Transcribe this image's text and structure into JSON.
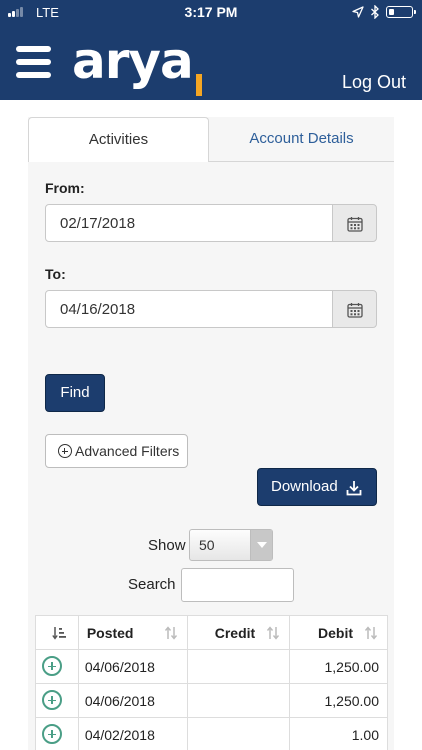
{
  "status_bar": {
    "carrier": "LTE",
    "time": "3:17 PM"
  },
  "header": {
    "logo_text": "arya",
    "logout_label": "Log Out"
  },
  "tabs": [
    {
      "label": "Activities",
      "active": true
    },
    {
      "label": "Account Details",
      "active": false
    }
  ],
  "form": {
    "from_label": "From:",
    "from_value": "02/17/2018",
    "to_label": "To:",
    "to_value": "04/16/2018",
    "find_label": "Find",
    "advanced_filters_label": "Advanced Filters",
    "download_label": "Download"
  },
  "table_controls": {
    "show_label": "Show",
    "show_value": "50",
    "search_label": "Search",
    "search_value": ""
  },
  "table": {
    "headers": [
      "",
      "Posted",
      "Credit",
      "Debit"
    ],
    "rows": [
      {
        "posted": "04/06/2018",
        "credit": "",
        "debit": "1,250.00"
      },
      {
        "posted": "04/06/2018",
        "credit": "",
        "debit": "1,250.00"
      },
      {
        "posted": "04/02/2018",
        "credit": "",
        "debit": "1.00"
      }
    ]
  },
  "colors": {
    "brand_navy": "#1c3d6e",
    "accent_orange": "#f5a623",
    "link_blue": "#2e5f9a",
    "expand_green": "#4a9e86"
  }
}
